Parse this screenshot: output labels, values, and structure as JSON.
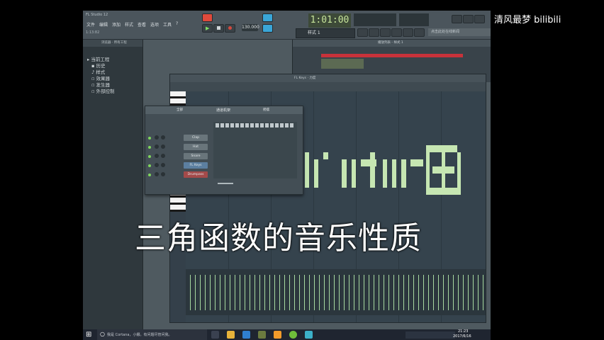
{
  "window": {
    "title": "FL Studio 12",
    "time_small": "1:13:82",
    "menu": [
      "文件",
      "编辑",
      "添加",
      "样式",
      "查看",
      "选项",
      "工具",
      "?"
    ]
  },
  "transport": {
    "bpm": "130.000",
    "time": "1:01:00",
    "pattern": "样式 1",
    "hint": "点击此处在线新闻"
  },
  "browser": {
    "header": "浏览器 · 所有工程",
    "items": [
      "当前工程",
      "历史",
      "样式",
      "效果器",
      "发生器",
      "外部控制"
    ]
  },
  "channel_rack": {
    "title": "通道机架",
    "filter": "全部",
    "swing": "摇摆",
    "channels": [
      "Clap",
      "Hat",
      "Snare",
      "FL Keys",
      "Drumpass"
    ]
  },
  "piano_roll": {
    "title": "FL Keys · 力度"
  },
  "playlist": {
    "title": "播放列表 - 样式 1"
  },
  "overlay": {
    "watermark": "清风最梦  bilibili",
    "subtitle": "三角函数的音乐性质"
  },
  "taskbar": {
    "search_placeholder": "我是 Cortana，小娜。有问题尽管问我。",
    "clock_time": "21:23",
    "clock_date": "2017/6/16"
  }
}
